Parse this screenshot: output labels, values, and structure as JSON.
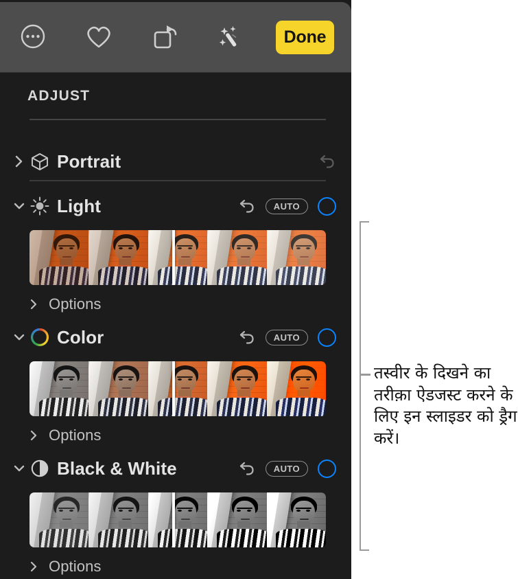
{
  "toolbar": {
    "buttons": [
      {
        "name": "more-options-icon",
        "label": "More Options"
      },
      {
        "name": "favorite-heart-icon",
        "label": "Favorite"
      },
      {
        "name": "crop-rotate-icon",
        "label": "Crop and Rotate"
      },
      {
        "name": "auto-enhance-wand-icon",
        "label": "Auto Enhance"
      }
    ],
    "done_label": "Done",
    "done_color": "#f6d42a"
  },
  "panel": {
    "section_title": "ADJUST",
    "accent_color": "#0a84ff",
    "background_color": "#1c1c1c",
    "toolbar_background_color": "#4d4d4d"
  },
  "adjustments": [
    {
      "id": "portrait",
      "label": "Portrait",
      "icon": "cube-icon",
      "expanded": false,
      "chevron": "chevron-right-icon",
      "has_reset": true,
      "reset_enabled": false,
      "has_auto": false,
      "has_toggle": false,
      "options_label": null
    },
    {
      "id": "light",
      "label": "Light",
      "icon": "sun-icon",
      "expanded": true,
      "chevron": "chevron-down-icon",
      "has_reset": true,
      "reset_enabled": true,
      "has_auto": true,
      "auto_label": "AUTO",
      "has_toggle": true,
      "toggle_state": "off",
      "slider_position_percent": 50,
      "options_label": "Options"
    },
    {
      "id": "color",
      "label": "Color",
      "icon": "color-wheel-icon",
      "expanded": true,
      "chevron": "chevron-down-icon",
      "has_reset": true,
      "reset_enabled": true,
      "has_auto": true,
      "auto_label": "AUTO",
      "has_toggle": true,
      "toggle_state": "off",
      "slider_position_percent": 50,
      "options_label": "Options"
    },
    {
      "id": "black-and-white",
      "label": "Black & White",
      "icon": "contrast-circle-icon",
      "expanded": true,
      "chevron": "chevron-down-icon",
      "has_reset": true,
      "reset_enabled": true,
      "has_auto": true,
      "auto_label": "AUTO",
      "has_toggle": true,
      "toggle_state": "off",
      "slider_position_percent": 50,
      "options_label": "Options"
    }
  ],
  "callout": {
    "text": "तस्वीर के दिखने का तरीक़ा ऐडजस्ट करने के लिए इन स्लाइडर को ड्रैग करें।",
    "bracket_color": "#9a9a9a"
  }
}
